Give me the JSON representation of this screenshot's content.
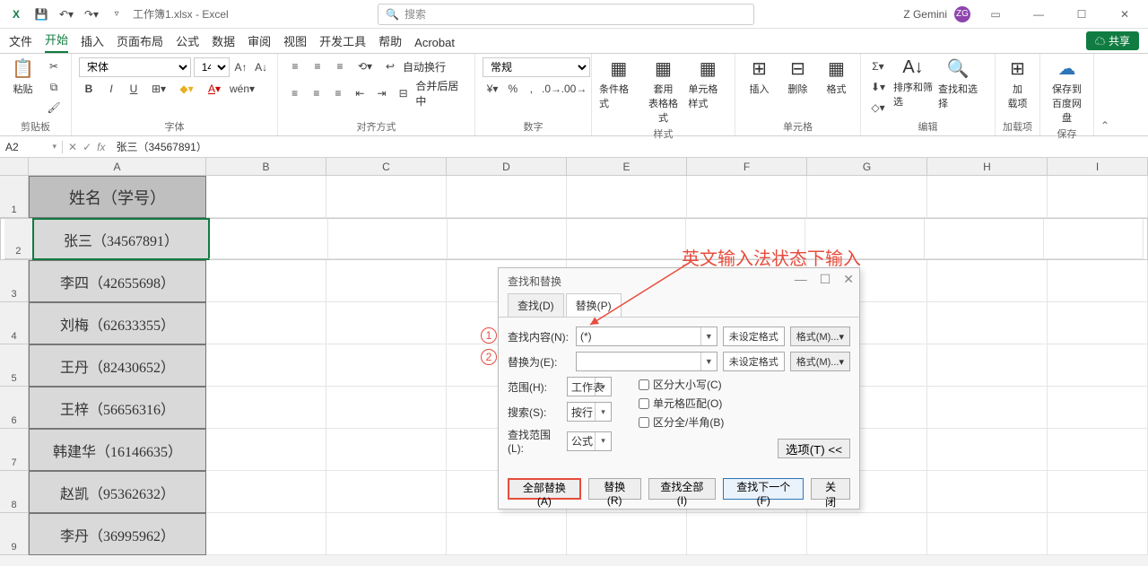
{
  "titlebar": {
    "filename": "工作簿1.xlsx - Excel",
    "search_placeholder": "搜索",
    "user_name": "Z Gemini",
    "user_initials": "ZG"
  },
  "tabs": {
    "items": [
      "文件",
      "开始",
      "插入",
      "页面布局",
      "公式",
      "数据",
      "审阅",
      "视图",
      "开发工具",
      "帮助",
      "Acrobat"
    ],
    "active_index": 1,
    "share": "共享"
  },
  "ribbon": {
    "clipboard": {
      "paste": "粘贴",
      "label": "剪贴板"
    },
    "font": {
      "name": "宋体",
      "size": "14",
      "label": "字体"
    },
    "align": {
      "wrap": "自动换行",
      "merge": "合并后居中",
      "label": "对齐方式"
    },
    "number": {
      "format": "常规",
      "label": "数字"
    },
    "styles": {
      "cond": "条件格式",
      "table": "套用\n表格格式",
      "cell": "单元格样式",
      "label": "样式"
    },
    "cells": {
      "insert": "插入",
      "delete": "删除",
      "format": "格式",
      "label": "单元格"
    },
    "editing": {
      "sort": "排序和筛选",
      "find": "查找和选择",
      "label": "编辑"
    },
    "addins": {
      "btn": "加\n载项",
      "label": "加载项"
    },
    "save": {
      "btn": "保存到\n百度网盘",
      "label": "保存"
    }
  },
  "fx": {
    "cell_ref": "A2",
    "formula": "张三（34567891）"
  },
  "grid": {
    "cols": [
      "A",
      "B",
      "C",
      "D",
      "E",
      "F",
      "G",
      "H",
      "I"
    ],
    "rows": [
      {
        "n": 1,
        "a": "姓名（学号）",
        "header": true
      },
      {
        "n": 2,
        "a": "张三（34567891）",
        "selected": true
      },
      {
        "n": 3,
        "a": "李四（42655698）"
      },
      {
        "n": 4,
        "a": "刘梅（62633355）"
      },
      {
        "n": 5,
        "a": "王丹（82430652）"
      },
      {
        "n": 6,
        "a": "王梓（56656316）"
      },
      {
        "n": 7,
        "a": "韩建华（16146635）"
      },
      {
        "n": 8,
        "a": "赵凯（95362632）"
      },
      {
        "n": 9,
        "a": "李丹（36995962）"
      }
    ]
  },
  "dialog": {
    "title": "查找和替换",
    "tab_find": "查找(D)",
    "tab_replace": "替换(P)",
    "find_label": "查找内容(N):",
    "find_value": "(*)",
    "replace_label": "替换为(E):",
    "replace_value": "",
    "no_format": "未设定格式",
    "format_btn": "格式(M)...",
    "scope_label": "范围(H):",
    "scope_value": "工作表",
    "search_label": "搜索(S):",
    "search_value": "按行",
    "lookin_label": "查找范围(L):",
    "lookin_value": "公式",
    "chk_case": "区分大小写(C)",
    "chk_whole": "单元格匹配(O)",
    "chk_width": "区分全/半角(B)",
    "options_btn": "选项(T) <<",
    "btn_replace_all": "全部替换(A)",
    "btn_replace": "替换(R)",
    "btn_find_all": "查找全部(I)",
    "btn_find_next": "查找下一个(F)",
    "btn_close": "关闭"
  },
  "annotations": {
    "note": "英文输入法状态下输入",
    "num1": "1",
    "num2": "2"
  }
}
